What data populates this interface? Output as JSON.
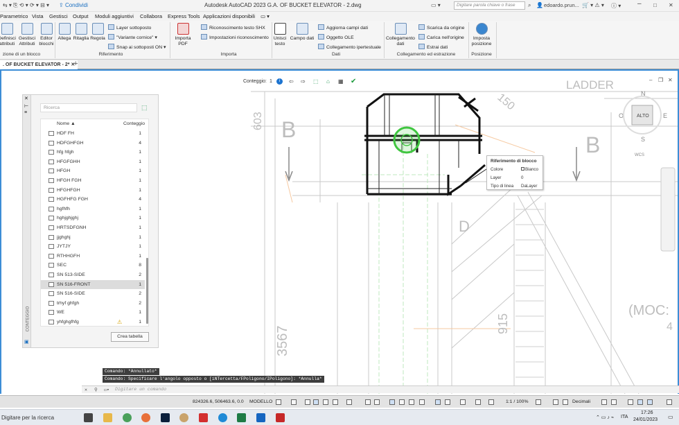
{
  "titlebar": {
    "share": "Condividi",
    "app_title": "Autodesk AutoCAD 2023   G.A. OF BUCKET ELEVATOR - 2.dwg",
    "search_placeholder": "Digitare parola chiave o frase",
    "user": "edoardo.prun..."
  },
  "menu": [
    "Parametrico",
    "Vista",
    "Gestisci",
    "Output",
    "Moduli aggiuntivi",
    "Collabora",
    "Express Tools",
    "Applicazioni disponibili"
  ],
  "ribbon": {
    "definisci": "Definisci attributi",
    "gestisci": "Gestisci Attributi",
    "editor": "Editor blocchi",
    "allega": "Allega",
    "ritaglia": "Ritaglia",
    "regola": "Regola",
    "layer_sottoposto": "Layer sottoposto",
    "varianti": "\"Variante cornice\"",
    "snap": "Snap ai sottoposti ON",
    "importa_pdf": "Importa PDF",
    "riconoscimento_shx": "Riconoscimento testo SHX",
    "impostazioni_ric": "Impostazioni riconoscimento",
    "unisci_testo": "Unisci testo",
    "campo_dati": "Campo dati",
    "aggiorna_campi": "Aggiorna campi dati",
    "oggetto_ole": "Oggetto OLE",
    "collegamento_ip": "Collegamento ipertestuale",
    "collegamento_dati": "Collegamento dati",
    "scarica": "Scarica da origine",
    "carica": "Carica nell'origine",
    "estrai": "Estrai  dati",
    "imposta_pos": "Imposta posizione",
    "panel_blocco": "zione di un blocco",
    "panel_riferimento": "Riferimento",
    "panel_importa": "Importa",
    "panel_dati": "Dati",
    "panel_collegamento": "Collegamento ed estrazione",
    "panel_posizione": "Posizione"
  },
  "doc_tab": ". OF BUCKET ELEVATOR - 2*",
  "count_toolbar": {
    "label": "Conteggio:",
    "value": "1"
  },
  "palette": {
    "search_placeholder": "Ricerca",
    "col_name": "Nome",
    "col_count": "Conteggio",
    "side_label": "CONTEGGIO",
    "button": "Crea tabella",
    "rows": [
      {
        "name": "HDF FH",
        "count": "1"
      },
      {
        "name": "HDFGHFGH",
        "count": "4"
      },
      {
        "name": "hfg hfgh",
        "count": "1"
      },
      {
        "name": "HFGFGHH",
        "count": "1"
      },
      {
        "name": "HFGH",
        "count": "1"
      },
      {
        "name": "HFGH FGH",
        "count": "1"
      },
      {
        "name": "HFGHFGH",
        "count": "1"
      },
      {
        "name": "HGFHFG FGH",
        "count": "4"
      },
      {
        "name": "hgfhfh",
        "count": "1"
      },
      {
        "name": "hghjghjghj",
        "count": "1"
      },
      {
        "name": "HRTSDFGNH",
        "count": "1"
      },
      {
        "name": "jjghghj",
        "count": "1"
      },
      {
        "name": "JYTJY",
        "count": "1"
      },
      {
        "name": "RTHHGFH",
        "count": "1"
      },
      {
        "name": "SEC",
        "count": "8"
      },
      {
        "name": "SN 513-SIDE",
        "count": "2"
      },
      {
        "name": "SN 516-FRONT",
        "count": "1"
      },
      {
        "name": "SN 516-SIDE",
        "count": "2"
      },
      {
        "name": "trhyf ghfgh",
        "count": "2"
      },
      {
        "name": "WE",
        "count": "1"
      },
      {
        "name": "yhfghgfhfg",
        "count": "1"
      }
    ]
  },
  "tooltip": {
    "title": "Riferimento di blocco",
    "rows": [
      [
        "Colore",
        "Bianco"
      ],
      [
        "Layer",
        "0"
      ],
      [
        "Tipo di linea",
        "DaLayer"
      ]
    ]
  },
  "drawing_text": {
    "ladder": "LADDER",
    "b_left": "B",
    "b_right": "B",
    "d": "D",
    "moc": "(MOC:",
    "moc2": "4",
    "dim_603": "603",
    "dim_150": "150",
    "dim_3567": "3567",
    "dim_915": "915"
  },
  "viewcube": {
    "n": "N",
    "e": "E",
    "s": "S",
    "top": "ALTO",
    "wcs": "WCS"
  },
  "command": {
    "hist1": "Comando: *Annullato*",
    "hist2": "Comando: Specificare l'angolo opposto o [iNTercetta/FPoligono/IPoligono]: *Annulla*",
    "placeholder": "Digitare un comando"
  },
  "status": {
    "coords": "824326.6, 506463.6, 0.0",
    "model": "MODELLO",
    "scale": "1:1 / 100%",
    "units": "Decimali"
  },
  "taskbar": {
    "search": "Digitare per la ricerca",
    "lang": "ITA",
    "time": "17:26",
    "date": "24/01/2023"
  }
}
